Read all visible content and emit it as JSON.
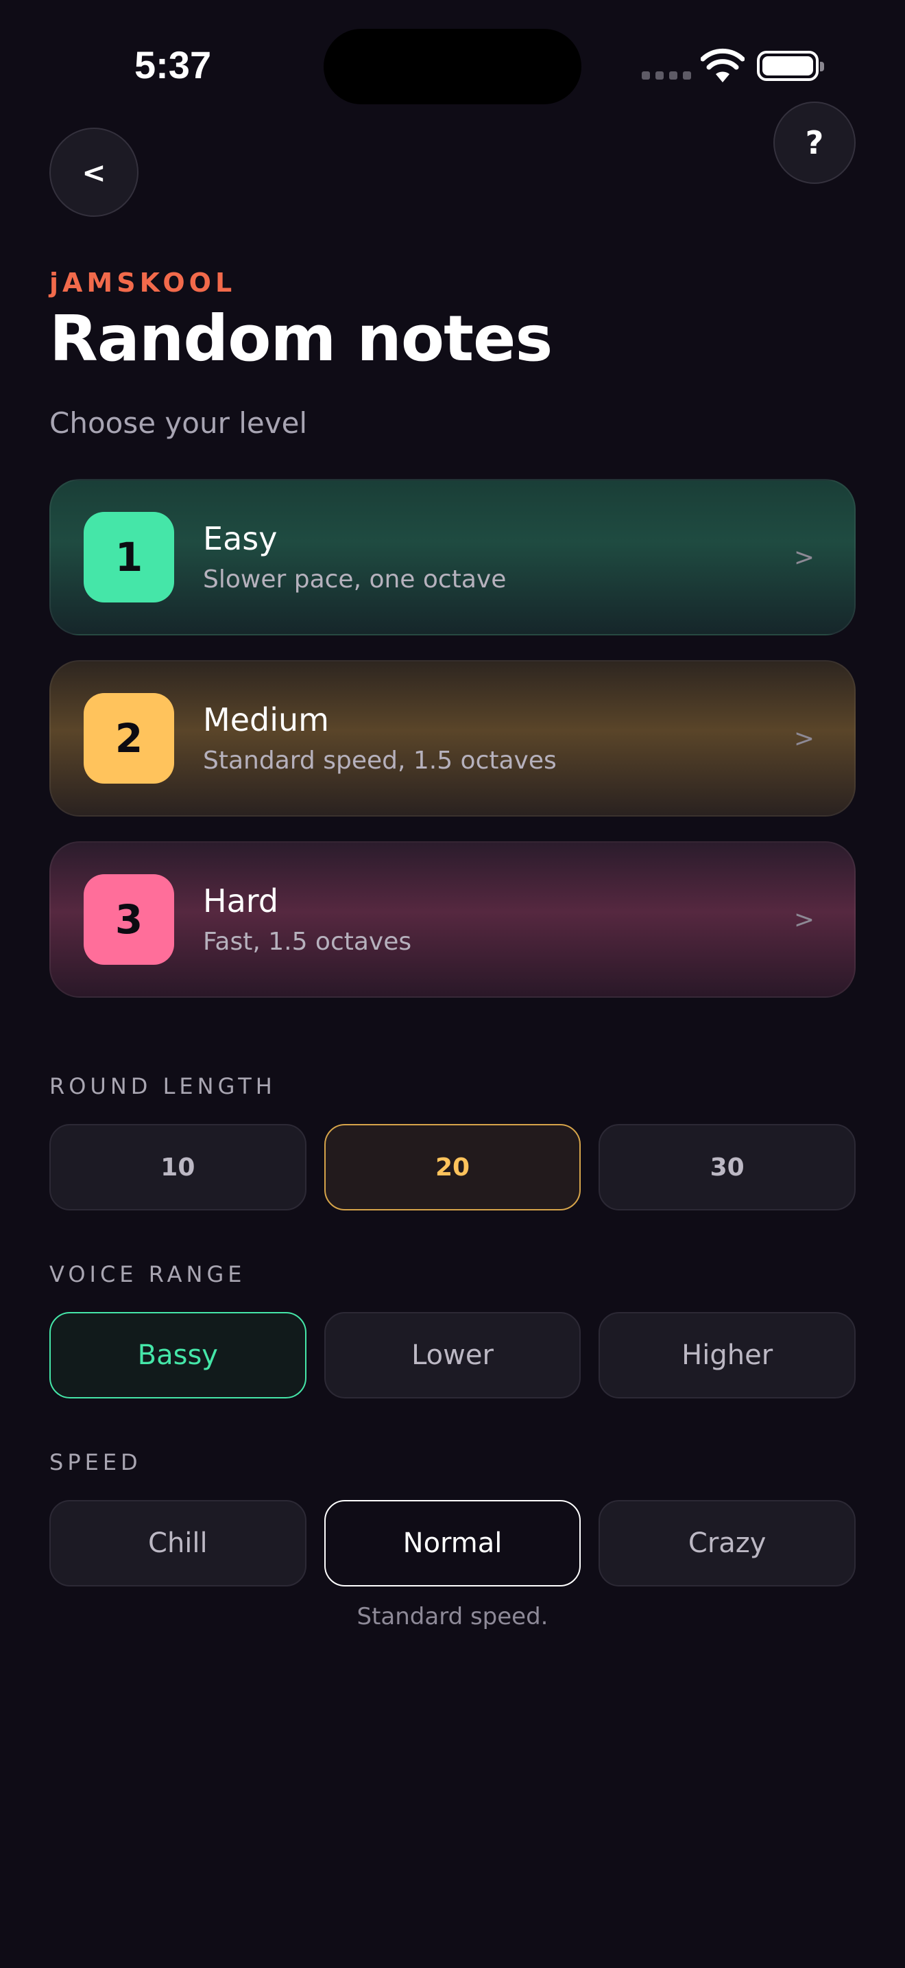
{
  "status": {
    "time": "5:37"
  },
  "nav": {
    "back_label": "<",
    "help_label": "?"
  },
  "header": {
    "brand": "jAMSKOOL",
    "title": "Random notes",
    "subtitle": "Choose your level"
  },
  "levels": [
    {
      "number": "1",
      "name": "Easy",
      "description": "Slower pace, one octave",
      "chevron": ">",
      "color": "#45e6a8"
    },
    {
      "number": "2",
      "name": "Medium",
      "description": "Standard speed, 1.5 octaves",
      "chevron": ">",
      "color": "#ffc35c"
    },
    {
      "number": "3",
      "name": "Hard",
      "description": "Fast, 1.5 octaves",
      "chevron": ">",
      "color": "#ff6e9a"
    }
  ],
  "round_length": {
    "label": "ROUND LENGTH",
    "options": [
      "10",
      "20",
      "30"
    ],
    "selected": "20"
  },
  "voice_range": {
    "label": "VOICE RANGE",
    "options": [
      "Bassy",
      "Lower",
      "Higher"
    ],
    "selected": "Bassy"
  },
  "speed": {
    "label": "SPEED",
    "options": [
      "Chill",
      "Normal",
      "Crazy"
    ],
    "selected": "Normal",
    "hint": "Standard speed."
  },
  "colors": {
    "background": "#0f0c16",
    "brand": "#f26a4b",
    "accent_yellow": "#ffc35c",
    "accent_green": "#45e6a8"
  }
}
